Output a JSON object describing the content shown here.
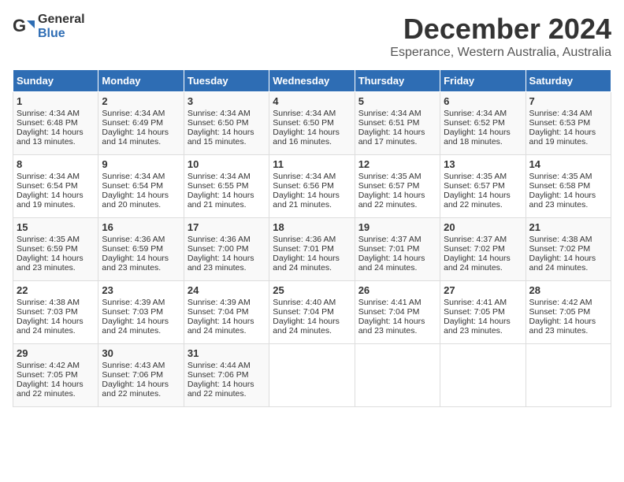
{
  "header": {
    "logo_general": "General",
    "logo_blue": "Blue",
    "month_title": "December 2024",
    "location": "Esperance, Western Australia, Australia"
  },
  "days_of_week": [
    "Sunday",
    "Monday",
    "Tuesday",
    "Wednesday",
    "Thursday",
    "Friday",
    "Saturday"
  ],
  "weeks": [
    [
      {
        "day": "1",
        "sunrise": "Sunrise: 4:34 AM",
        "sunset": "Sunset: 6:48 PM",
        "daylight": "Daylight: 14 hours and 13 minutes."
      },
      {
        "day": "2",
        "sunrise": "Sunrise: 4:34 AM",
        "sunset": "Sunset: 6:49 PM",
        "daylight": "Daylight: 14 hours and 14 minutes."
      },
      {
        "day": "3",
        "sunrise": "Sunrise: 4:34 AM",
        "sunset": "Sunset: 6:50 PM",
        "daylight": "Daylight: 14 hours and 15 minutes."
      },
      {
        "day": "4",
        "sunrise": "Sunrise: 4:34 AM",
        "sunset": "Sunset: 6:50 PM",
        "daylight": "Daylight: 14 hours and 16 minutes."
      },
      {
        "day": "5",
        "sunrise": "Sunrise: 4:34 AM",
        "sunset": "Sunset: 6:51 PM",
        "daylight": "Daylight: 14 hours and 17 minutes."
      },
      {
        "day": "6",
        "sunrise": "Sunrise: 4:34 AM",
        "sunset": "Sunset: 6:52 PM",
        "daylight": "Daylight: 14 hours and 18 minutes."
      },
      {
        "day": "7",
        "sunrise": "Sunrise: 4:34 AM",
        "sunset": "Sunset: 6:53 PM",
        "daylight": "Daylight: 14 hours and 19 minutes."
      }
    ],
    [
      {
        "day": "8",
        "sunrise": "Sunrise: 4:34 AM",
        "sunset": "Sunset: 6:54 PM",
        "daylight": "Daylight: 14 hours and 19 minutes."
      },
      {
        "day": "9",
        "sunrise": "Sunrise: 4:34 AM",
        "sunset": "Sunset: 6:54 PM",
        "daylight": "Daylight: 14 hours and 20 minutes."
      },
      {
        "day": "10",
        "sunrise": "Sunrise: 4:34 AM",
        "sunset": "Sunset: 6:55 PM",
        "daylight": "Daylight: 14 hours and 21 minutes."
      },
      {
        "day": "11",
        "sunrise": "Sunrise: 4:34 AM",
        "sunset": "Sunset: 6:56 PM",
        "daylight": "Daylight: 14 hours and 21 minutes."
      },
      {
        "day": "12",
        "sunrise": "Sunrise: 4:35 AM",
        "sunset": "Sunset: 6:57 PM",
        "daylight": "Daylight: 14 hours and 22 minutes."
      },
      {
        "day": "13",
        "sunrise": "Sunrise: 4:35 AM",
        "sunset": "Sunset: 6:57 PM",
        "daylight": "Daylight: 14 hours and 22 minutes."
      },
      {
        "day": "14",
        "sunrise": "Sunrise: 4:35 AM",
        "sunset": "Sunset: 6:58 PM",
        "daylight": "Daylight: 14 hours and 23 minutes."
      }
    ],
    [
      {
        "day": "15",
        "sunrise": "Sunrise: 4:35 AM",
        "sunset": "Sunset: 6:59 PM",
        "daylight": "Daylight: 14 hours and 23 minutes."
      },
      {
        "day": "16",
        "sunrise": "Sunrise: 4:36 AM",
        "sunset": "Sunset: 6:59 PM",
        "daylight": "Daylight: 14 hours and 23 minutes."
      },
      {
        "day": "17",
        "sunrise": "Sunrise: 4:36 AM",
        "sunset": "Sunset: 7:00 PM",
        "daylight": "Daylight: 14 hours and 23 minutes."
      },
      {
        "day": "18",
        "sunrise": "Sunrise: 4:36 AM",
        "sunset": "Sunset: 7:01 PM",
        "daylight": "Daylight: 14 hours and 24 minutes."
      },
      {
        "day": "19",
        "sunrise": "Sunrise: 4:37 AM",
        "sunset": "Sunset: 7:01 PM",
        "daylight": "Daylight: 14 hours and 24 minutes."
      },
      {
        "day": "20",
        "sunrise": "Sunrise: 4:37 AM",
        "sunset": "Sunset: 7:02 PM",
        "daylight": "Daylight: 14 hours and 24 minutes."
      },
      {
        "day": "21",
        "sunrise": "Sunrise: 4:38 AM",
        "sunset": "Sunset: 7:02 PM",
        "daylight": "Daylight: 14 hours and 24 minutes."
      }
    ],
    [
      {
        "day": "22",
        "sunrise": "Sunrise: 4:38 AM",
        "sunset": "Sunset: 7:03 PM",
        "daylight": "Daylight: 14 hours and 24 minutes."
      },
      {
        "day": "23",
        "sunrise": "Sunrise: 4:39 AM",
        "sunset": "Sunset: 7:03 PM",
        "daylight": "Daylight: 14 hours and 24 minutes."
      },
      {
        "day": "24",
        "sunrise": "Sunrise: 4:39 AM",
        "sunset": "Sunset: 7:04 PM",
        "daylight": "Daylight: 14 hours and 24 minutes."
      },
      {
        "day": "25",
        "sunrise": "Sunrise: 4:40 AM",
        "sunset": "Sunset: 7:04 PM",
        "daylight": "Daylight: 14 hours and 24 minutes."
      },
      {
        "day": "26",
        "sunrise": "Sunrise: 4:41 AM",
        "sunset": "Sunset: 7:04 PM",
        "daylight": "Daylight: 14 hours and 23 minutes."
      },
      {
        "day": "27",
        "sunrise": "Sunrise: 4:41 AM",
        "sunset": "Sunset: 7:05 PM",
        "daylight": "Daylight: 14 hours and 23 minutes."
      },
      {
        "day": "28",
        "sunrise": "Sunrise: 4:42 AM",
        "sunset": "Sunset: 7:05 PM",
        "daylight": "Daylight: 14 hours and 23 minutes."
      }
    ],
    [
      {
        "day": "29",
        "sunrise": "Sunrise: 4:42 AM",
        "sunset": "Sunset: 7:05 PM",
        "daylight": "Daylight: 14 hours and 22 minutes."
      },
      {
        "day": "30",
        "sunrise": "Sunrise: 4:43 AM",
        "sunset": "Sunset: 7:06 PM",
        "daylight": "Daylight: 14 hours and 22 minutes."
      },
      {
        "day": "31",
        "sunrise": "Sunrise: 4:44 AM",
        "sunset": "Sunset: 7:06 PM",
        "daylight": "Daylight: 14 hours and 22 minutes."
      },
      null,
      null,
      null,
      null
    ]
  ]
}
